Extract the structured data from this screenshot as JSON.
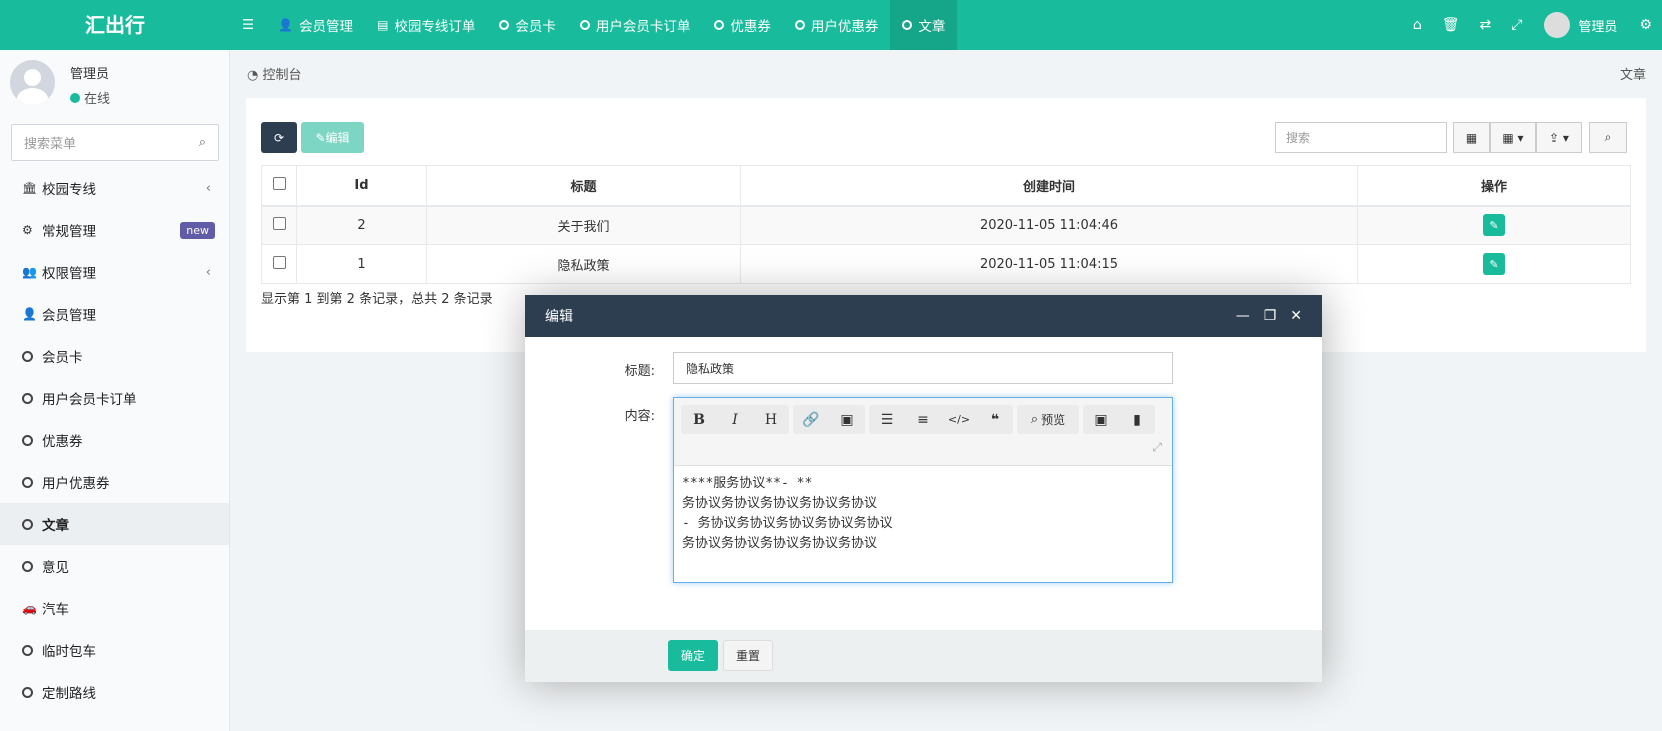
{
  "app": {
    "logo": "汇出行"
  },
  "topnav": {
    "items": [
      {
        "icon": "user-icon",
        "label": "会员管理"
      },
      {
        "icon": "list-icon",
        "label": "校园专线订单"
      },
      {
        "icon": "circle-icon",
        "label": "会员卡"
      },
      {
        "icon": "circle-icon",
        "label": "用户会员卡订单"
      },
      {
        "icon": "circle-icon",
        "label": "优惠券"
      },
      {
        "icon": "circle-icon",
        "label": "用户优惠券"
      },
      {
        "icon": "circle-icon",
        "label": "文章"
      }
    ],
    "user": "管理员"
  },
  "sidebar": {
    "user_name": "管理员",
    "status": "在线",
    "search_placeholder": "搜索菜单",
    "items": [
      {
        "icon": "bank-icon",
        "label": "校园专线"
      },
      {
        "icon": "cogs-icon",
        "label": "常规管理",
        "badge": "new"
      },
      {
        "icon": "users-icon",
        "label": "权限管理"
      },
      {
        "icon": "user-icon",
        "label": "会员管理"
      },
      {
        "icon": "circle-icon",
        "label": "会员卡"
      },
      {
        "icon": "circle-icon",
        "label": "用户会员卡订单"
      },
      {
        "icon": "circle-icon",
        "label": "优惠券"
      },
      {
        "icon": "circle-icon",
        "label": "用户优惠券"
      },
      {
        "icon": "circle-icon",
        "label": "文章"
      },
      {
        "icon": "circle-icon",
        "label": "意见"
      },
      {
        "icon": "car-icon",
        "label": "汽车"
      },
      {
        "icon": "circle-icon",
        "label": "临时包车"
      },
      {
        "icon": "circle-icon",
        "label": "定制路线"
      }
    ]
  },
  "breadcrumb": {
    "home": "控制台",
    "current": "文章"
  },
  "toolbar": {
    "edit_label": "编辑",
    "search_placeholder": "搜索"
  },
  "table": {
    "columns": [
      "Id",
      "标题",
      "创建时间",
      "操作"
    ],
    "rows": [
      {
        "id": "2",
        "title": "关于我们",
        "created": "2020-11-05 11:04:46"
      },
      {
        "id": "1",
        "title": "隐私政策",
        "created": "2020-11-05 11:04:15"
      }
    ],
    "page_info": "显示第 1 到第 2 条记录，总共 2 条记录"
  },
  "modal": {
    "title": "编辑",
    "title_label": "标题:",
    "title_value": "隐私政策",
    "content_label": "内容:",
    "preview_label": "预览",
    "content_lines": [
      "****服务协议**- **",
      "务协议务协议务协议务协议务协议",
      "- 务协议务协议务协议务协议务协议",
      "务协议务协议务协议务协议务协议"
    ],
    "ok_label": "确定",
    "reset_label": "重置"
  },
  "colors": {
    "primary": "#18bc9c",
    "dark": "#2c3e50",
    "badge": "#605ca8"
  }
}
